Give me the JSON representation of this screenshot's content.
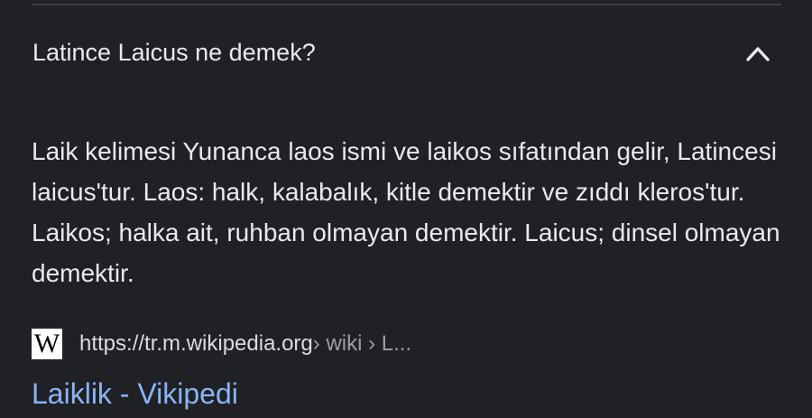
{
  "faq": {
    "question": "Latince Laicus ne demek?",
    "expanded": true,
    "toggle_icon": "chevron-up-icon",
    "answer": "Laik kelimesi Yunanca laos ismi ve laikos sıfatından gelir, Latincesi laicus'tur. Laos: halk, kalabalık, kitle demektir ve zıddı kleros'tur. Laikos; halka ait, ruhban olmayan demektir. Laicus; dinsel olmayan demektir."
  },
  "source": {
    "favicon_icon": "wikipedia-icon",
    "favicon_glyph": "W",
    "url_host": "https://tr.m.wikipedia.org",
    "url_path": " › wiki › L...",
    "title": "Laiklik - Vikipedi"
  },
  "colors": {
    "background": "#202124",
    "text": "#e8eaed",
    "link": "#8ab4f8",
    "muted": "#9aa0a6",
    "divider": "#3c4043"
  }
}
